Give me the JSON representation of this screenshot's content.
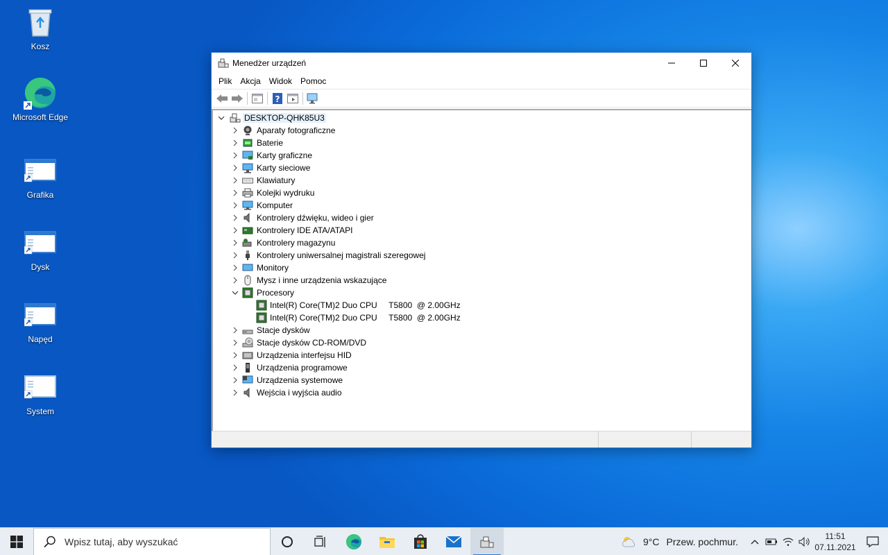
{
  "desktop": {
    "icons": [
      {
        "label": "Kosz",
        "icon": "recycle-bin-icon"
      },
      {
        "label": "Microsoft Edge",
        "icon": "edge-icon"
      },
      {
        "label": "Grafika",
        "icon": "shortcut-window-icon"
      },
      {
        "label": "Dysk",
        "icon": "shortcut-window-icon"
      },
      {
        "label": "Napęd",
        "icon": "shortcut-window-icon"
      },
      {
        "label": "System",
        "icon": "shortcut-window-icon"
      }
    ]
  },
  "window": {
    "title": "Menedżer urządzeń",
    "menu": [
      "Plik",
      "Akcja",
      "Widok",
      "Pomoc"
    ],
    "toolbar": [
      "back-icon",
      "forward-icon",
      "properties-icon",
      "help-icon",
      "view-icon",
      "monitor-scan-icon"
    ]
  },
  "tree": {
    "root": "DESKTOP-QHK85U3",
    "categories": [
      {
        "label": "Aparaty fotograficzne",
        "icon": "camera-icon",
        "expanded": false
      },
      {
        "label": "Baterie",
        "icon": "battery-icon",
        "expanded": false
      },
      {
        "label": "Karty graficzne",
        "icon": "display-adapter-icon",
        "expanded": false
      },
      {
        "label": "Karty sieciowe",
        "icon": "network-adapter-icon",
        "expanded": false
      },
      {
        "label": "Klawiatury",
        "icon": "keyboard-icon",
        "expanded": false
      },
      {
        "label": "Kolejki wydruku",
        "icon": "printer-icon",
        "expanded": false
      },
      {
        "label": "Komputer",
        "icon": "computer-icon",
        "expanded": false
      },
      {
        "label": "Kontrolery dźwięku, wideo i gier",
        "icon": "speaker-icon",
        "expanded": false
      },
      {
        "label": "Kontrolery IDE ATA/ATAPI",
        "icon": "ide-controller-icon",
        "expanded": false
      },
      {
        "label": "Kontrolery magazynu",
        "icon": "storage-controller-icon",
        "expanded": false
      },
      {
        "label": "Kontrolery uniwersalnej magistrali szeregowej",
        "icon": "usb-icon",
        "expanded": false
      },
      {
        "label": "Monitory",
        "icon": "monitor-icon",
        "expanded": false
      },
      {
        "label": "Mysz i inne urządzenia wskazujące",
        "icon": "mouse-icon",
        "expanded": false
      },
      {
        "label": "Procesory",
        "icon": "processor-icon",
        "expanded": true,
        "children": [
          "Intel(R) Core(TM)2 Duo CPU     T5800  @ 2.00GHz",
          "Intel(R) Core(TM)2 Duo CPU     T5800  @ 2.00GHz"
        ]
      },
      {
        "label": "Stacje dysków",
        "icon": "disk-drive-icon",
        "expanded": false
      },
      {
        "label": "Stacje dysków CD-ROM/DVD",
        "icon": "cdrom-icon",
        "expanded": false
      },
      {
        "label": "Urządzenia interfejsu HID",
        "icon": "hid-icon",
        "expanded": false
      },
      {
        "label": "Urządzenia programowe",
        "icon": "software-device-icon",
        "expanded": false
      },
      {
        "label": "Urządzenia systemowe",
        "icon": "system-device-icon",
        "expanded": false
      },
      {
        "label": "Wejścia i wyjścia audio",
        "icon": "audio-io-icon",
        "expanded": false
      }
    ]
  },
  "taskbar": {
    "search_placeholder": "Wpisz tutaj, aby wyszukać",
    "apps": [
      "cortana-icon",
      "task-view-icon",
      "edge-icon",
      "file-explorer-icon",
      "store-icon",
      "mail-icon",
      "device-manager-icon"
    ],
    "weather": {
      "temp": "9°C",
      "desc": "Przew. pochmur."
    },
    "clock": {
      "time": "11:51",
      "date": "07.11.2021"
    }
  }
}
